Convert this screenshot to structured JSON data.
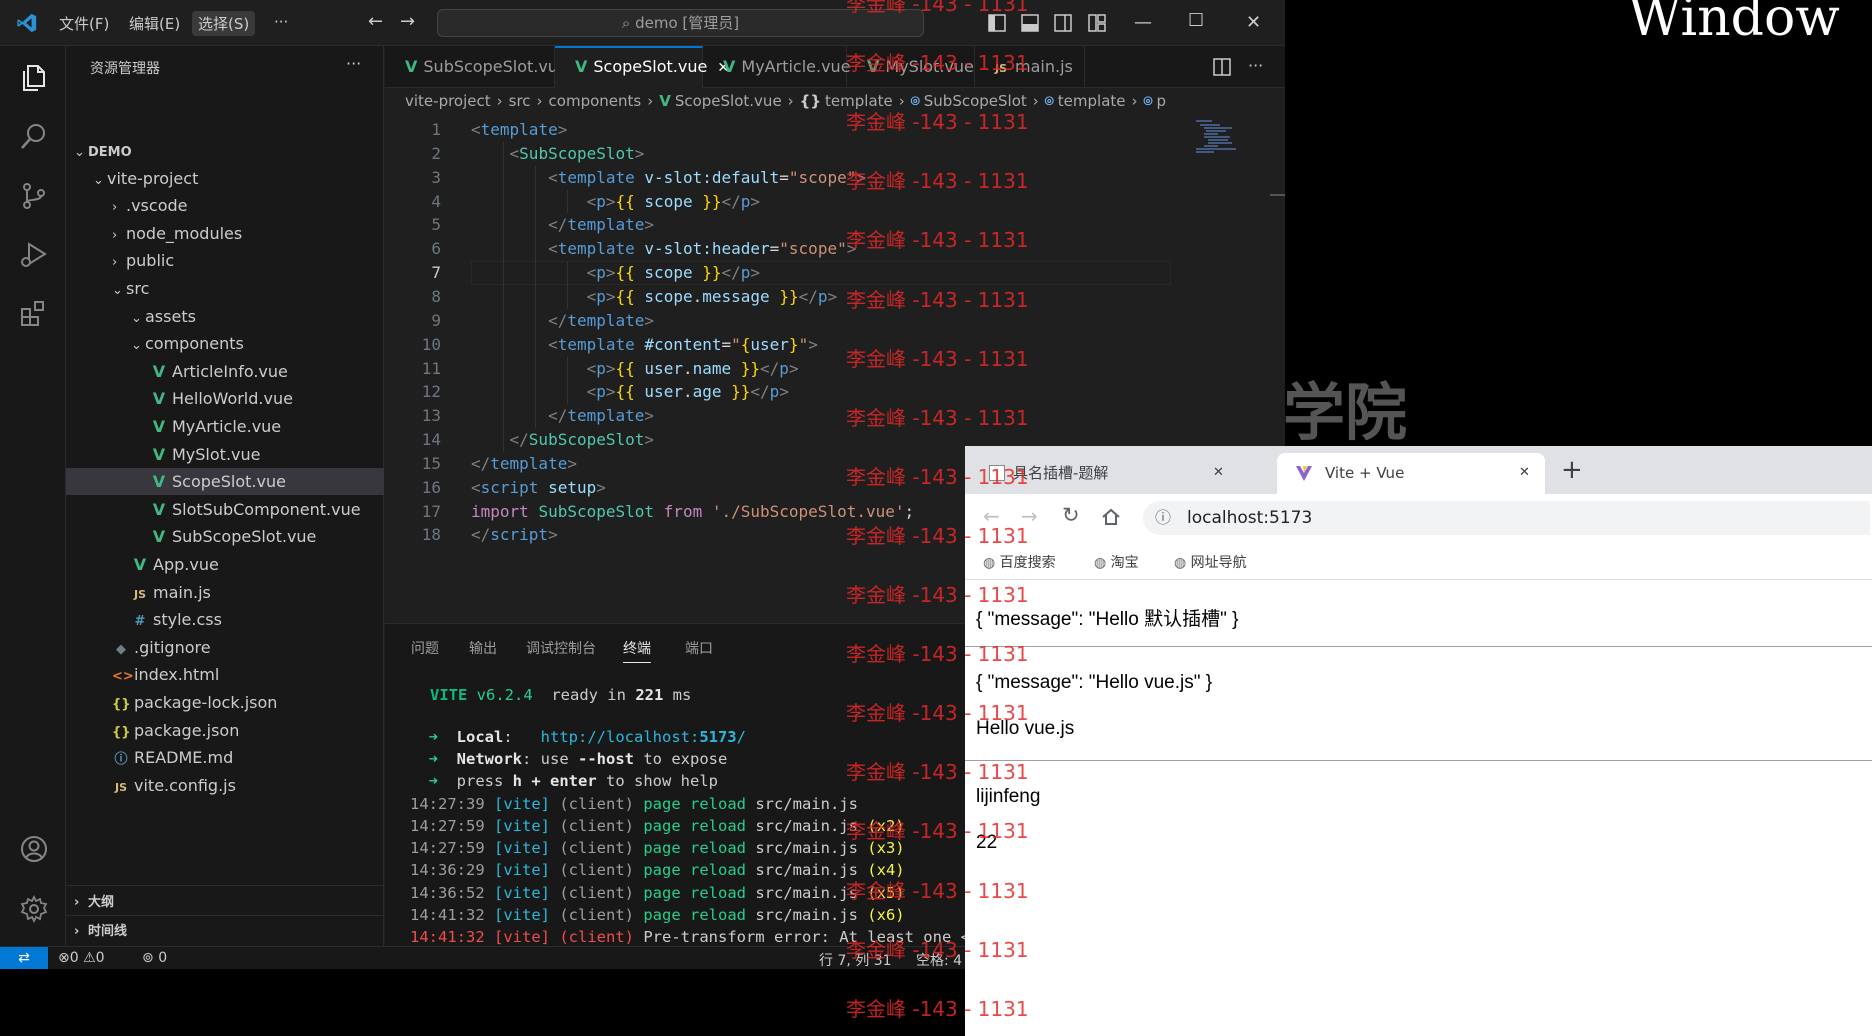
{
  "background": {
    "text": "Window",
    "mark": "学院"
  },
  "titlebar": {
    "menu": [
      "文件(F)",
      "编辑(E)",
      "选择(S)"
    ],
    "more": "···",
    "search": "demo [管理员]"
  },
  "sidebar": {
    "title": "资源管理器",
    "more": "···",
    "items": [
      {
        "label": "DEMO",
        "depth": 0,
        "kind": "folder-open"
      },
      {
        "label": "vite-project",
        "depth": 1,
        "kind": "folder-open"
      },
      {
        "label": ".vscode",
        "depth": 2,
        "kind": "folder"
      },
      {
        "label": "node_modules",
        "depth": 2,
        "kind": "folder"
      },
      {
        "label": "public",
        "depth": 2,
        "kind": "folder"
      },
      {
        "label": "src",
        "depth": 2,
        "kind": "folder-open"
      },
      {
        "label": "assets",
        "depth": 3,
        "kind": "folder-open"
      },
      {
        "label": "components",
        "depth": 3,
        "kind": "folder-open"
      },
      {
        "label": "ArticleInfo.vue",
        "depth": 4,
        "kind": "vue"
      },
      {
        "label": "HelloWorld.vue",
        "depth": 4,
        "kind": "vue"
      },
      {
        "label": "MyArticle.vue",
        "depth": 4,
        "kind": "vue"
      },
      {
        "label": "MySlot.vue",
        "depth": 4,
        "kind": "vue"
      },
      {
        "label": "ScopeSlot.vue",
        "depth": 4,
        "kind": "vue",
        "selected": true
      },
      {
        "label": "SlotSubComponent.vue",
        "depth": 4,
        "kind": "vue"
      },
      {
        "label": "SubScopeSlot.vue",
        "depth": 4,
        "kind": "vue"
      },
      {
        "label": "App.vue",
        "depth": 3,
        "kind": "vue"
      },
      {
        "label": "main.js",
        "depth": 3,
        "kind": "js"
      },
      {
        "label": "style.css",
        "depth": 3,
        "kind": "css"
      },
      {
        "label": ".gitignore",
        "depth": 2,
        "kind": "git"
      },
      {
        "label": "index.html",
        "depth": 2,
        "kind": "html"
      },
      {
        "label": "package-lock.json",
        "depth": 2,
        "kind": "json"
      },
      {
        "label": "package.json",
        "depth": 2,
        "kind": "json"
      },
      {
        "label": "README.md",
        "depth": 2,
        "kind": "info"
      },
      {
        "label": "vite.config.js",
        "depth": 2,
        "kind": "js"
      }
    ],
    "outline": "大纲",
    "timeline": "时间线"
  },
  "tabs": [
    {
      "label": "SubScopeSlot.vue",
      "kind": "vue"
    },
    {
      "label": "ScopeSlot.vue",
      "kind": "vue",
      "active": true,
      "close": "✕"
    },
    {
      "label": "MyArticle.vue",
      "kind": "vue"
    },
    {
      "label": "MySlot.vue",
      "kind": "vue"
    },
    {
      "label": "main.js",
      "kind": "js"
    }
  ],
  "breadcrumb": [
    "vite-project",
    "src",
    "components",
    "ScopeSlot.vue",
    "template",
    "SubScopeSlot",
    "template",
    "p"
  ],
  "code": {
    "current_line": 7,
    "lines": [
      [
        [
          "t-br",
          "<"
        ],
        [
          "t-tag",
          "template"
        ],
        [
          "t-br",
          ">"
        ]
      ],
      [
        [
          "t-txt",
          "    "
        ],
        [
          "t-br",
          "<"
        ],
        [
          "t-comp",
          "SubScopeSlot"
        ],
        [
          "t-br",
          ">"
        ]
      ],
      [
        [
          "t-txt",
          "        "
        ],
        [
          "t-br",
          "<"
        ],
        [
          "t-tag",
          "template"
        ],
        [
          "t-txt",
          " "
        ],
        [
          "t-attr",
          "v-slot:default"
        ],
        [
          "t-txt",
          "="
        ],
        [
          "t-str",
          "\"scope\""
        ],
        [
          "t-br",
          ">"
        ]
      ],
      [
        [
          "t-txt",
          "            "
        ],
        [
          "t-br",
          "<"
        ],
        [
          "t-tag",
          "p"
        ],
        [
          "t-br",
          ">"
        ],
        [
          "t-mus",
          "{{"
        ],
        [
          "t-txt",
          " "
        ],
        [
          "t-var",
          "scope"
        ],
        [
          "t-txt",
          " "
        ],
        [
          "t-mus",
          "}}"
        ],
        [
          "t-br",
          "</"
        ],
        [
          "t-tag",
          "p"
        ],
        [
          "t-br",
          ">"
        ]
      ],
      [
        [
          "t-txt",
          "        "
        ],
        [
          "t-br",
          "</"
        ],
        [
          "t-tag",
          "template"
        ],
        [
          "t-br",
          ">"
        ]
      ],
      [
        [
          "t-txt",
          "        "
        ],
        [
          "t-br",
          "<"
        ],
        [
          "t-tag",
          "template"
        ],
        [
          "t-txt",
          " "
        ],
        [
          "t-attr",
          "v-slot:header"
        ],
        [
          "t-txt",
          "="
        ],
        [
          "t-str",
          "\"scope\""
        ],
        [
          "t-br",
          ">"
        ]
      ],
      [
        [
          "t-txt",
          "            "
        ],
        [
          "t-br",
          "<"
        ],
        [
          "t-tag",
          "p"
        ],
        [
          "t-br",
          ">"
        ],
        [
          "t-mus",
          "{{"
        ],
        [
          "t-txt",
          " "
        ],
        [
          "t-var",
          "scope"
        ],
        [
          "t-txt",
          " "
        ],
        [
          "t-mus",
          "}}"
        ],
        [
          "t-br",
          "</"
        ],
        [
          "t-tag",
          "p"
        ],
        [
          "t-br",
          ">"
        ]
      ],
      [
        [
          "t-txt",
          "            "
        ],
        [
          "t-br",
          "<"
        ],
        [
          "t-tag",
          "p"
        ],
        [
          "t-br",
          ">"
        ],
        [
          "t-mus",
          "{{"
        ],
        [
          "t-txt",
          " "
        ],
        [
          "t-var",
          "scope"
        ],
        [
          "t-txt",
          "."
        ],
        [
          "t-var",
          "message"
        ],
        [
          "t-txt",
          " "
        ],
        [
          "t-mus",
          "}}"
        ],
        [
          "t-br",
          "</"
        ],
        [
          "t-tag",
          "p"
        ],
        [
          "t-br",
          ">"
        ]
      ],
      [
        [
          "t-txt",
          "        "
        ],
        [
          "t-br",
          "</"
        ],
        [
          "t-tag",
          "template"
        ],
        [
          "t-br",
          ">"
        ]
      ],
      [
        [
          "t-txt",
          "        "
        ],
        [
          "t-br",
          "<"
        ],
        [
          "t-tag",
          "template"
        ],
        [
          "t-txt",
          " "
        ],
        [
          "t-attr",
          "#content"
        ],
        [
          "t-txt",
          "="
        ],
        [
          "t-str",
          "\""
        ],
        [
          "t-mus",
          "{"
        ],
        [
          "t-var",
          "user"
        ],
        [
          "t-mus",
          "}"
        ],
        [
          "t-str",
          "\""
        ],
        [
          "t-br",
          ">"
        ]
      ],
      [
        [
          "t-txt",
          "            "
        ],
        [
          "t-br",
          "<"
        ],
        [
          "t-tag",
          "p"
        ],
        [
          "t-br",
          ">"
        ],
        [
          "t-mus",
          "{{"
        ],
        [
          "t-txt",
          " "
        ],
        [
          "t-var",
          "user"
        ],
        [
          "t-txt",
          "."
        ],
        [
          "t-var",
          "name"
        ],
        [
          "t-txt",
          " "
        ],
        [
          "t-mus",
          "}}"
        ],
        [
          "t-br",
          "</"
        ],
        [
          "t-tag",
          "p"
        ],
        [
          "t-br",
          ">"
        ]
      ],
      [
        [
          "t-txt",
          "            "
        ],
        [
          "t-br",
          "<"
        ],
        [
          "t-tag",
          "p"
        ],
        [
          "t-br",
          ">"
        ],
        [
          "t-mus",
          "{{"
        ],
        [
          "t-txt",
          " "
        ],
        [
          "t-var",
          "user"
        ],
        [
          "t-txt",
          "."
        ],
        [
          "t-var",
          "age"
        ],
        [
          "t-txt",
          " "
        ],
        [
          "t-mus",
          "}}"
        ],
        [
          "t-br",
          "</"
        ],
        [
          "t-tag",
          "p"
        ],
        [
          "t-br",
          ">"
        ]
      ],
      [
        [
          "t-txt",
          "        "
        ],
        [
          "t-br",
          "</"
        ],
        [
          "t-tag",
          "template"
        ],
        [
          "t-br",
          ">"
        ]
      ],
      [
        [
          "t-txt",
          "    "
        ],
        [
          "t-br",
          "</"
        ],
        [
          "t-comp",
          "SubScopeSlot"
        ],
        [
          "t-br",
          ">"
        ]
      ],
      [
        [
          "t-br",
          "</"
        ],
        [
          "t-tag",
          "template"
        ],
        [
          "t-br",
          ">"
        ]
      ],
      [
        [
          "t-br",
          "<"
        ],
        [
          "t-tag",
          "script"
        ],
        [
          "t-txt",
          " "
        ],
        [
          "t-attr",
          "setup"
        ],
        [
          "t-br",
          ">"
        ]
      ],
      [
        [
          "t-kw",
          "import"
        ],
        [
          "t-txt",
          " "
        ],
        [
          "t-comp",
          "SubScopeSlot"
        ],
        [
          "t-txt",
          " "
        ],
        [
          "t-kw",
          "from"
        ],
        [
          "t-txt",
          " "
        ],
        [
          "t-str",
          "'./SubScopeSlot.vue'"
        ],
        [
          "t-txt",
          ";"
        ]
      ],
      [
        [
          "t-br",
          "</"
        ],
        [
          "t-tag",
          "script"
        ],
        [
          "t-br",
          ">"
        ]
      ]
    ]
  },
  "panel": {
    "tabs": [
      "问题",
      "输出",
      "调试控制台",
      "终端",
      "端口"
    ],
    "active_tab": "终端",
    "terminal": [
      [
        [
          "c-green2 bold",
          "VITE"
        ],
        [
          "c-green",
          " v6.2.4"
        ],
        [
          "",
          "  ready in "
        ],
        [
          "c-white",
          "221"
        ],
        [
          "",
          " ms"
        ]
      ],
      [
        [
          "",
          ""
        ]
      ],
      [
        [
          "c-green",
          "  ➜  "
        ],
        [
          "c-white",
          "Local"
        ],
        [
          "",
          ":   "
        ],
        [
          "c-url",
          "http://localhost:"
        ],
        [
          "c-url bold",
          "5173"
        ],
        [
          "c-url",
          "/"
        ]
      ],
      [
        [
          "c-green",
          "  ➜  "
        ],
        [
          "c-white",
          "Network"
        ],
        [
          "",
          ": use "
        ],
        [
          "c-white",
          "--host"
        ],
        [
          "",
          " to expose"
        ]
      ],
      [
        [
          "c-green",
          "  ➜  "
        ],
        [
          "",
          "press "
        ],
        [
          "c-white",
          "h + enter"
        ],
        [
          "",
          " to show help"
        ]
      ],
      [
        [
          "c-gray",
          "14:27:39 "
        ],
        [
          "c-cyan",
          "[vite]"
        ],
        [
          "c-gray",
          " (client) "
        ],
        [
          "c-green",
          "page reload "
        ],
        [
          "",
          "src/main.js"
        ]
      ],
      [
        [
          "c-gray",
          "14:27:59 "
        ],
        [
          "c-cyan",
          "[vite]"
        ],
        [
          "c-gray",
          " (client) "
        ],
        [
          "c-green",
          "page reload "
        ],
        [
          "",
          "src/main.js "
        ],
        [
          "c-yellow",
          "(x2)"
        ]
      ],
      [
        [
          "c-gray",
          "14:27:59 "
        ],
        [
          "c-cyan",
          "[vite]"
        ],
        [
          "c-gray",
          " (client) "
        ],
        [
          "c-green",
          "page reload "
        ],
        [
          "",
          "src/main.js "
        ],
        [
          "c-yellow",
          "(x3)"
        ]
      ],
      [
        [
          "c-gray",
          "14:36:29 "
        ],
        [
          "c-cyan",
          "[vite]"
        ],
        [
          "c-gray",
          " (client) "
        ],
        [
          "c-green",
          "page reload "
        ],
        [
          "",
          "src/main.js "
        ],
        [
          "c-yellow",
          "(x4)"
        ]
      ],
      [
        [
          "c-gray",
          "14:36:52 "
        ],
        [
          "c-cyan",
          "[vite]"
        ],
        [
          "c-gray",
          " (client) "
        ],
        [
          "c-green",
          "page reload "
        ],
        [
          "",
          "src/main.js "
        ],
        [
          "c-yellow",
          "(x5)"
        ]
      ],
      [
        [
          "c-gray",
          "14:41:32 "
        ],
        [
          "c-cyan",
          "[vite]"
        ],
        [
          "c-gray",
          " (client) "
        ],
        [
          "c-green",
          "page reload "
        ],
        [
          "",
          "src/main.js "
        ],
        [
          "c-yellow",
          "(x6)"
        ]
      ],
      [
        [
          "c-red",
          "14:41:32 "
        ],
        [
          "c-red",
          "[vite]"
        ],
        [
          "c-red",
          " (client) "
        ],
        [
          "",
          "Pre-transform error: At least one <te"
        ]
      ]
    ]
  },
  "statusbar": {
    "errors": "0",
    "warnings": "0",
    "ports": "0",
    "position": "行 7, 列 31",
    "spaces": "空格: 4"
  },
  "browser": {
    "tabs": [
      {
        "label": "具名插槽-题解",
        "close": "✕"
      },
      {
        "label": "Vite + Vue",
        "close": "✕",
        "active": true
      }
    ],
    "new_tab": "+",
    "url": "localhost:5173",
    "bookmarks": [
      "百度搜索",
      "淘宝",
      "网址导航"
    ],
    "content": [
      "{ \"message\": \"Hello 默认插槽\" }",
      "{ \"message\": \"Hello vue.js\" }",
      "Hello vue.js",
      "lijinfeng",
      "22"
    ]
  },
  "watermark": "李金峰 -143 - 1131"
}
